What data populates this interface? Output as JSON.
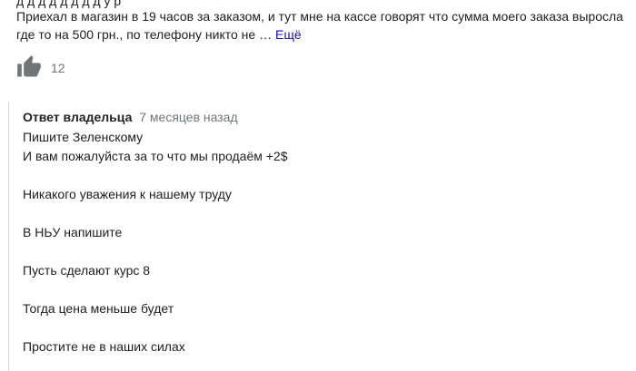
{
  "review": {
    "cut_line": "д    д   д    д             д      д   д              д    у                 р    ",
    "text": "Приехал в магазин в 19 часов за заказом, и тут мне на кассе говорят что сумма моего заказа выросла где то на 500 грн., по телефону никто не … ",
    "more_label": "Ещё",
    "like_count": "12"
  },
  "reply": {
    "author": "Ответ владельца",
    "time": "7 месяцев назад",
    "lines": [
      "Пишите Зеленскому",
      "И вам пожалуйста за то что мы продаём +2$",
      "",
      "Никакого уважения к нашему труду",
      "",
      "В НЬУ напишите",
      "",
      "Пусть сделают курс 8",
      "",
      "Тогда цена меньше будет",
      "",
      "Простите не в наших силах"
    ]
  },
  "icons": {
    "like": "thumbs-up-icon"
  },
  "colors": {
    "link": "#1a0dab",
    "muted": "#70757a",
    "icon": "#70757a",
    "rule": "#dadce0"
  }
}
